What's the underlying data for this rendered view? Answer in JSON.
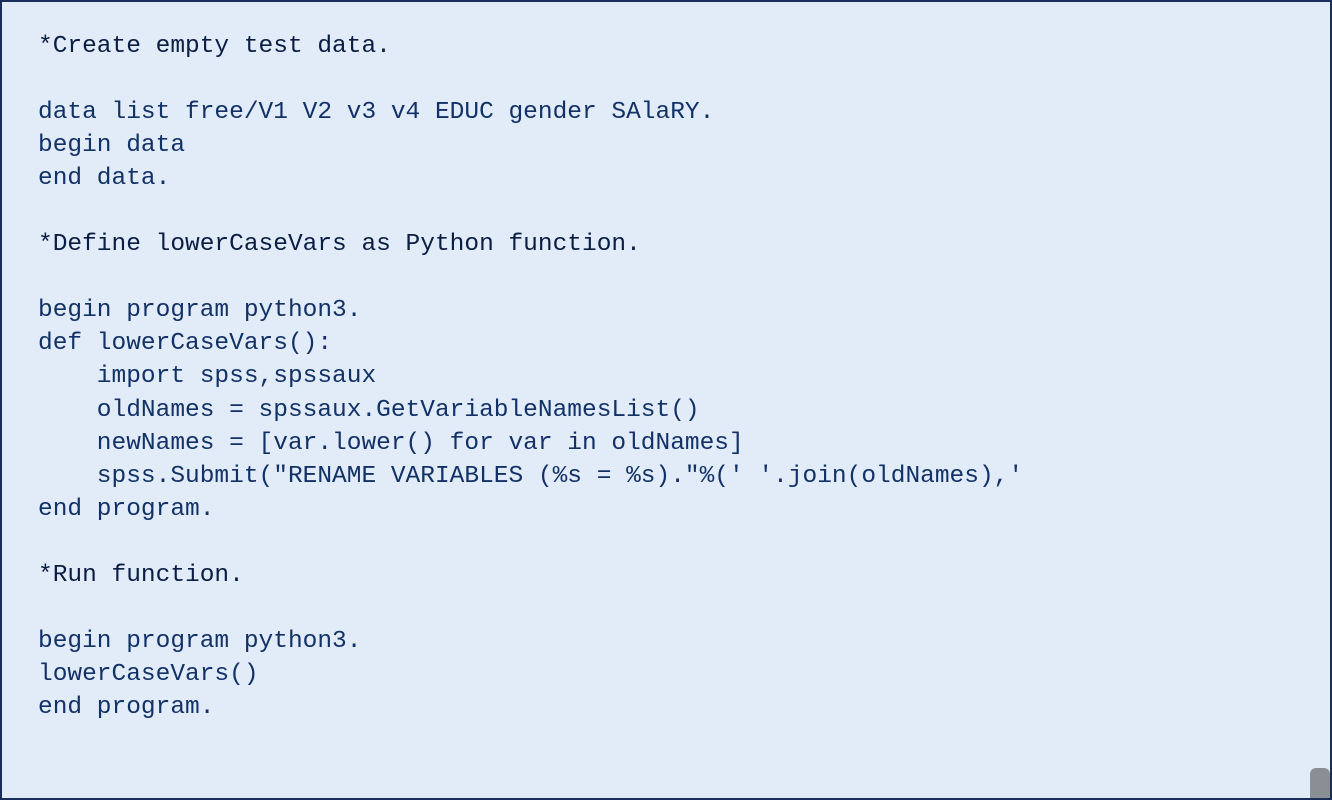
{
  "code": {
    "comment1": "*Create empty test data.",
    "block1_line1": "data list free/V1 V2 v3 v4 EDUC gender SAlaRY.",
    "block1_line2": "begin data",
    "block1_line3": "end data.",
    "comment2": "*Define lowerCaseVars as Python function.",
    "block2_line1": "begin program python3.",
    "block2_line2": "def lowerCaseVars():",
    "block2_line3": "    import spss,spssaux",
    "block2_line4": "    oldNames = spssaux.GetVariableNamesList()",
    "block2_line5": "    newNames = [var.lower() for var in oldNames]",
    "block2_line6": "    spss.Submit(\"RENAME VARIABLES (%s = %s).\"%(' '.join(oldNames),'",
    "block2_line7": "end program.",
    "comment3": "*Run function.",
    "block3_line1": "begin program python3.",
    "block3_line2": "lowerCaseVars()",
    "block3_line3": "end program."
  }
}
